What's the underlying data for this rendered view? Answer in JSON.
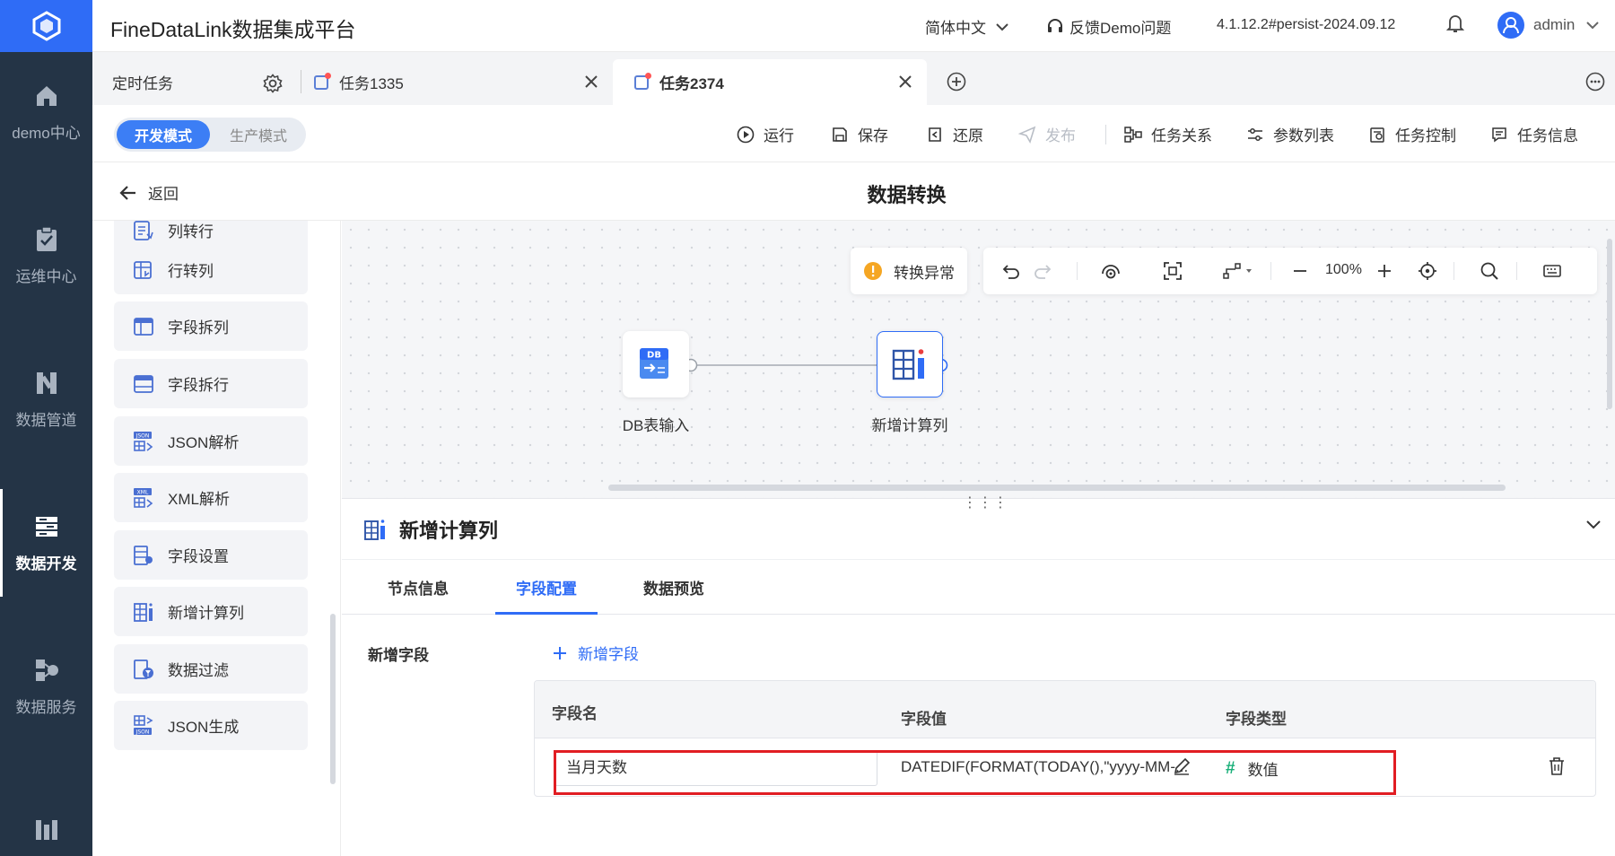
{
  "app": {
    "title": "FineDataLink数据集成平台"
  },
  "header": {
    "language": "简体中文",
    "feedback": "反馈Demo问题",
    "version": "4.1.12.2#persist-2024.09.12",
    "user": "admin"
  },
  "leftnav": {
    "items": [
      {
        "label": "demo中心",
        "icon": "home-icon"
      },
      {
        "label": "运维中心",
        "icon": "clipboard-check-icon"
      },
      {
        "label": "数据管道",
        "icon": "pipeline-icon"
      },
      {
        "label": "数据开发",
        "icon": "dev-icon"
      },
      {
        "label": "数据服务",
        "icon": "service-icon"
      }
    ]
  },
  "tabs": [
    {
      "label": "定时任务"
    },
    {
      "label": "任务1335"
    },
    {
      "label": "任务2374"
    }
  ],
  "toolbar": {
    "mode_dev": "开发模式",
    "mode_prod": "生产模式",
    "run": "运行",
    "save": "保存",
    "restore": "还原",
    "publish": "发布",
    "relations": "任务关系",
    "params": "参数列表",
    "control": "任务控制",
    "info": "任务信息"
  },
  "page": {
    "back": "返回",
    "title": "数据转换"
  },
  "components": [
    {
      "label": "列转行",
      "icon": "col-to-row-icon"
    },
    {
      "label": "行转列",
      "icon": "row-to-col-icon"
    },
    {
      "label": "字段拆列",
      "icon": "split-column-icon"
    },
    {
      "label": "字段拆行",
      "icon": "split-row-icon"
    },
    {
      "label": "JSON解析",
      "icon": "json-parse-icon"
    },
    {
      "label": "XML解析",
      "icon": "xml-parse-icon"
    },
    {
      "label": "字段设置",
      "icon": "field-settings-icon"
    },
    {
      "label": "新增计算列",
      "icon": "calc-column-icon"
    },
    {
      "label": "数据过滤",
      "icon": "filter-icon"
    },
    {
      "label": "JSON生成",
      "icon": "json-generate-icon"
    }
  ],
  "canvas": {
    "warning": "转换异常",
    "zoom": "100%",
    "nodes": [
      {
        "label": "DB表输入",
        "icon_text": "DB"
      },
      {
        "label": "新增计算列"
      }
    ]
  },
  "detail": {
    "title": "新增计算列",
    "tabs": [
      "节点信息",
      "字段配置",
      "数据预览"
    ],
    "active_tab": "字段配置",
    "new_field_label": "新增字段",
    "add_field": "新增字段",
    "columns": [
      "字段名",
      "字段值",
      "字段类型"
    ],
    "row": {
      "name": "当月天数",
      "value": "DATEDIF(FORMAT(TODAY(),\"yyyy-MM-...",
      "type": "数值",
      "type_symbol": "#"
    }
  },
  "colors": {
    "accent": "#2f6cf6",
    "nav_bg": "#243446",
    "highlight": "#e11d23",
    "number_type": "#1bb07a",
    "warning": "#f5a623"
  }
}
